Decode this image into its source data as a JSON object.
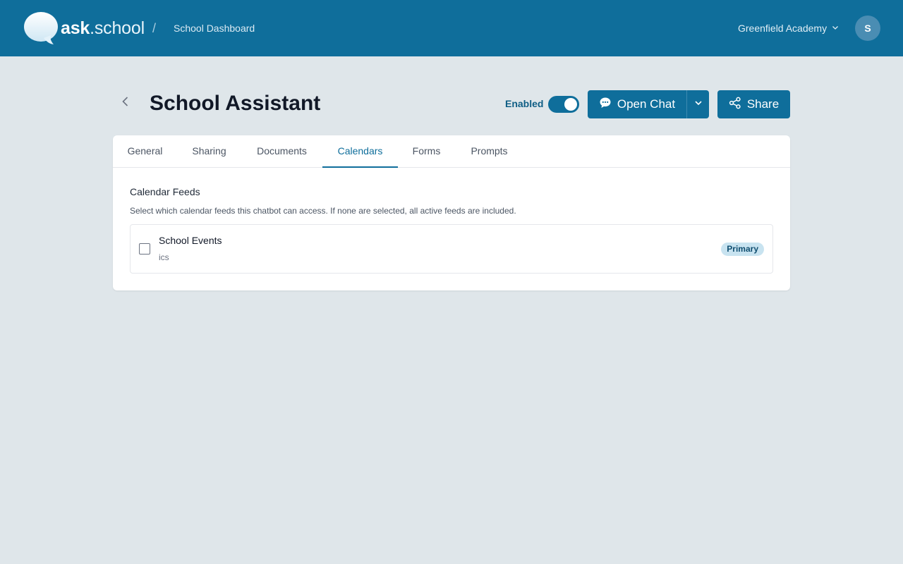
{
  "header": {
    "logo_bold": "ask",
    "logo_rest": ".school",
    "separator": "/",
    "breadcrumb": "School Dashboard",
    "school_name": "Greenfield Academy",
    "avatar_initial": "S",
    "background_color": "#0f6e9b"
  },
  "page": {
    "title": "School Assistant",
    "enabled_label": "Enabled",
    "enabled": true,
    "open_chat_label": "Open Chat",
    "share_label": "Share",
    "accent_color": "#0f6e9b"
  },
  "tabs": [
    {
      "label": "General",
      "active": false
    },
    {
      "label": "Sharing",
      "active": false
    },
    {
      "label": "Documents",
      "active": false
    },
    {
      "label": "Calendars",
      "active": true
    },
    {
      "label": "Forms",
      "active": false
    },
    {
      "label": "Prompts",
      "active": false
    }
  ],
  "calendars": {
    "section_title": "Calendar Feeds",
    "description": "Select which calendar feeds this chatbot can access. If none are selected, all active feeds are included.",
    "feeds": [
      {
        "name": "School Events",
        "type": "ics",
        "badge": "Primary",
        "checked": false
      }
    ]
  },
  "icons": {
    "logo": "speech-bubble-icon",
    "school_dropdown": "chevron-down-icon",
    "back": "chevron-left-icon",
    "chat": "chat-bubble-icon",
    "chat_dropdown": "chevron-down-icon",
    "share": "share-icon"
  }
}
